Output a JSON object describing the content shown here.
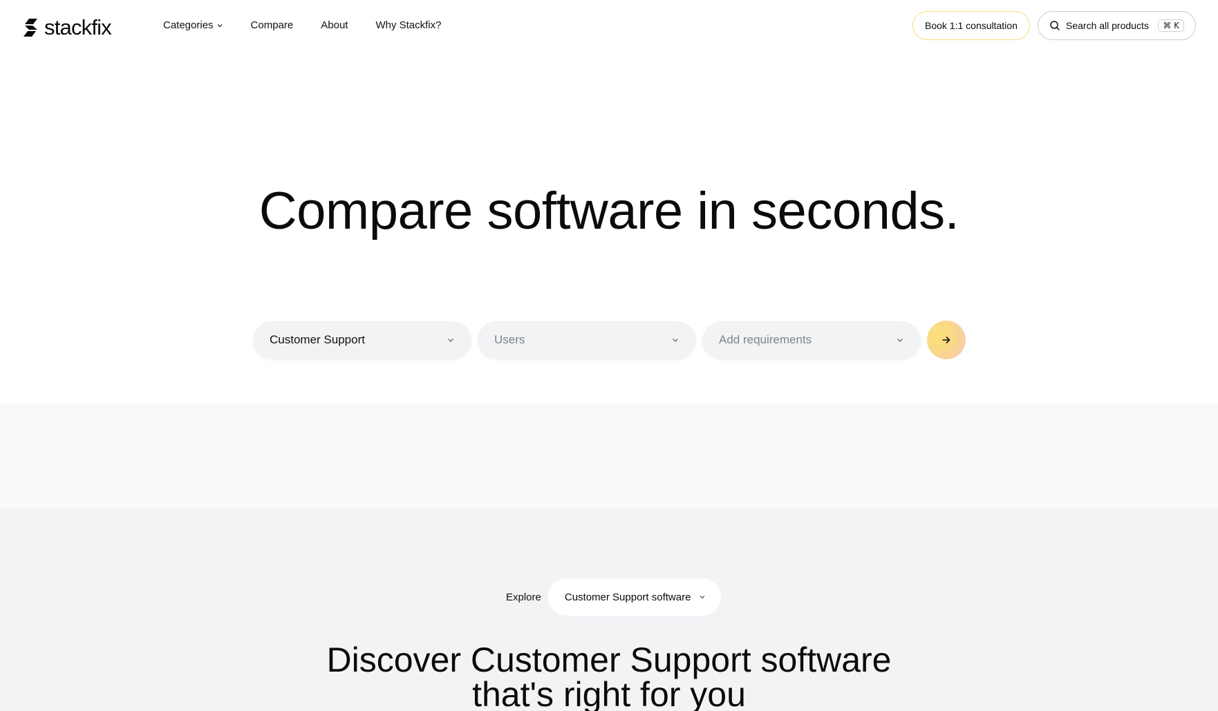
{
  "brand": {
    "name": "stackfix"
  },
  "nav": {
    "items": [
      {
        "label": "Categories",
        "has_dropdown": true
      },
      {
        "label": "Compare"
      },
      {
        "label": "About"
      },
      {
        "label": "Why Stackfix?"
      }
    ]
  },
  "header": {
    "consult_label": "Book 1:1 consultation",
    "search_label": "Search all products",
    "search_shortcut": "⌘ K"
  },
  "hero": {
    "title": "Compare software in seconds.",
    "filters": {
      "category_value": "Customer Support",
      "users_placeholder": "Users",
      "requirements_placeholder": "Add requirements"
    },
    "submit_icon": "arrow-right-icon"
  },
  "explore": {
    "label": "Explore",
    "selected": "Customer Support software"
  },
  "discover": {
    "line1": "Discover Customer Support software",
    "line2": "that's right for you"
  },
  "colors": {
    "band_light": "#f8f9fa",
    "band_gray": "#f1f3f5",
    "consult_border": "#f4df7a",
    "accent_gradient_start": "#fbe17a",
    "accent_gradient_end": "#f6c6c4"
  }
}
